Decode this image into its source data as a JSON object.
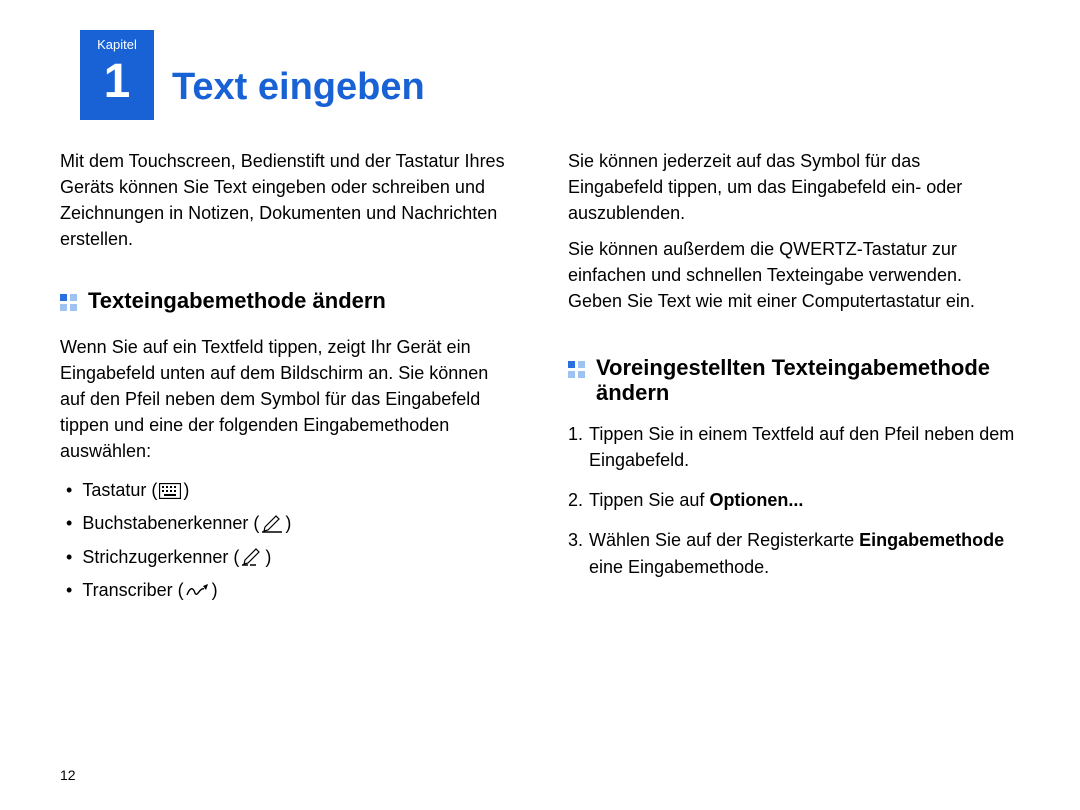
{
  "chapter": {
    "label": "Kapitel",
    "number": "1"
  },
  "title": "Text eingeben",
  "page_number": "12",
  "col1": {
    "intro": "Mit dem Touchscreen, Bedienstift und der Tastatur Ihres Geräts können Sie Text eingeben oder schreiben und Zeichnungen in Notizen, Dokumenten und Nachrichten erstellen.",
    "section1_heading": "Texteingabemethode ändern",
    "section1_p1": "Wenn Sie auf ein Textfeld tippen, zeigt Ihr Gerät ein Eingabefeld unten auf dem Bildschirm an. Sie können auf den Pfeil neben dem Symbol für das Eingabefeld tippen und eine der folgenden Eingabemethoden auswählen:",
    "bullets": {
      "b1": "Tastatur (",
      "b2": "Buchstabenerkenner (",
      "b3": "Strichzugerkenner (",
      "b4": "Transcriber (",
      "close": ")"
    }
  },
  "col2": {
    "p1": "Sie können jederzeit auf das Symbol für das Eingabefeld tippen, um das Eingabefeld ein- oder auszublenden.",
    "p2": "Sie können außerdem die QWERTZ-Tastatur zur einfachen und schnellen Texteingabe verwenden. Geben Sie Text wie mit einer Computertastatur ein.",
    "section2_heading": "Voreingestellten Texteingabemethode ändern",
    "steps": {
      "s1": "Tippen Sie in einem Textfeld auf den Pfeil neben dem Eingabefeld.",
      "s2_pre": "Tippen Sie auf ",
      "s2_bold": "Optionen...",
      "s3_pre": "Wählen Sie auf der Registerkarte ",
      "s3_bold": "Eingabemethode",
      "s3_post": " eine Eingabemethode."
    }
  }
}
